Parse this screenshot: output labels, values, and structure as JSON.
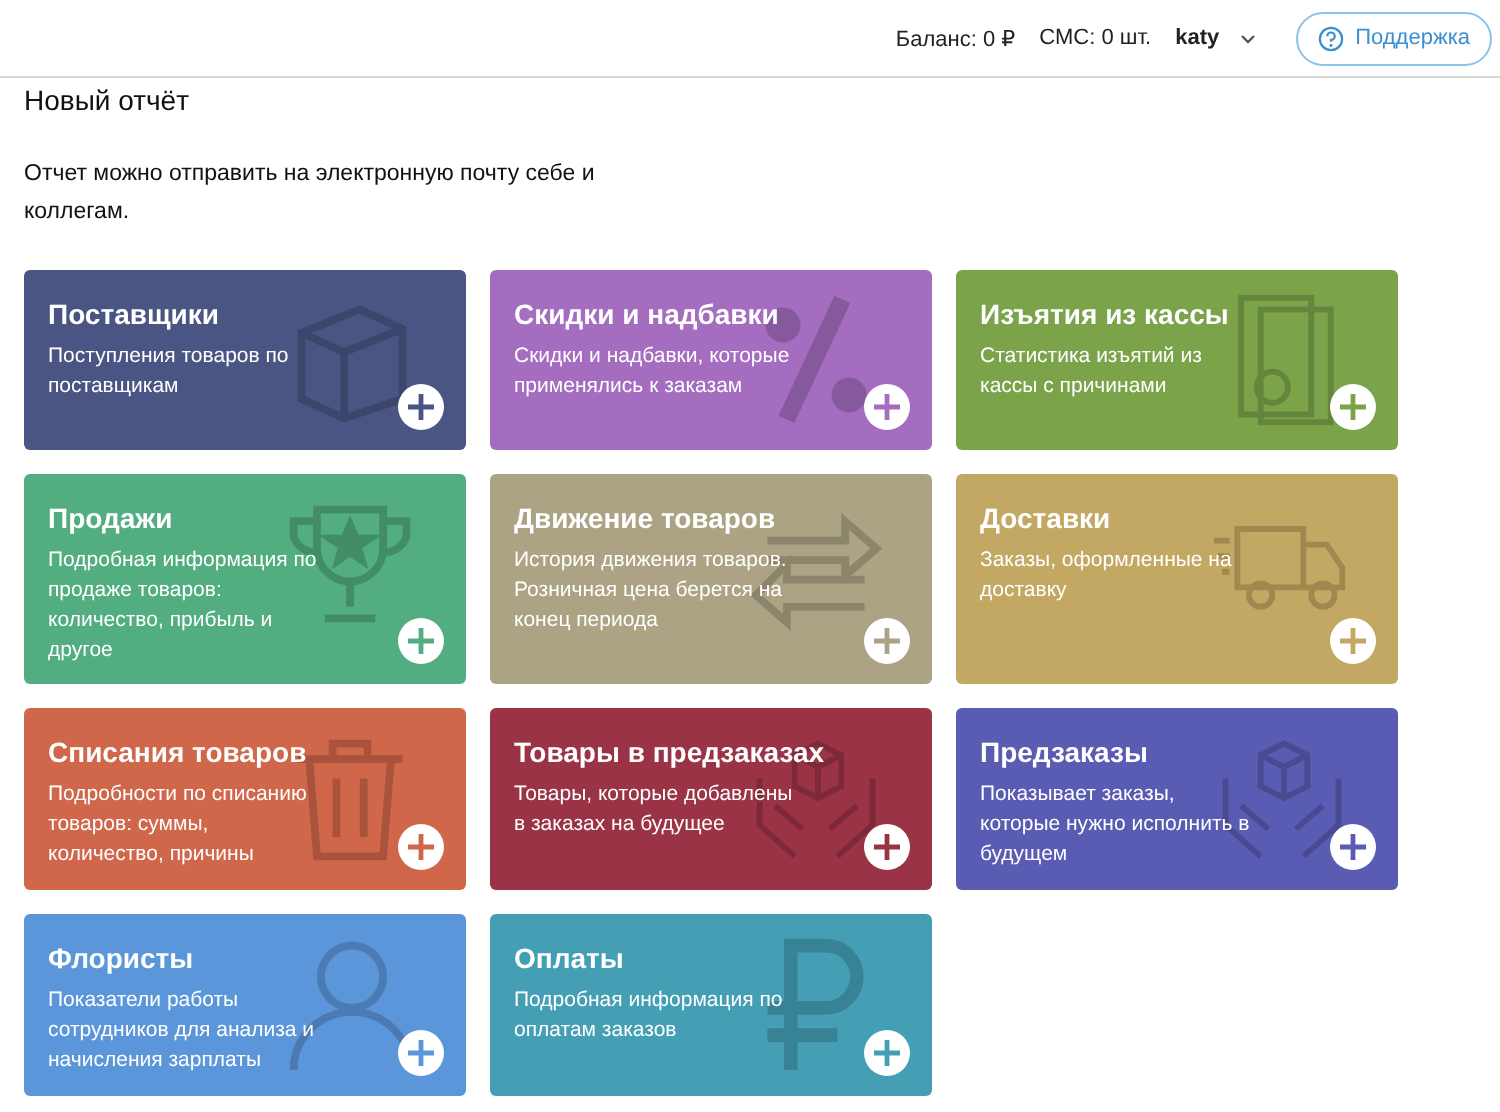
{
  "header": {
    "balance": "Баланс: 0 ₽",
    "sms": "СМС: 0 шт.",
    "user": "katy",
    "support_button": "Поддержка"
  },
  "page": {
    "title": "Новый отчёт",
    "description": "Отчет можно отправить на электронную почту себе и коллегам."
  },
  "reports": [
    {
      "title": "Поставщики",
      "description": "Поступления товаров по поставщикам",
      "color": "#4a5584"
    },
    {
      "title": "Скидки и надбавки",
      "description": "Скидки и надбавки, которые применялись к заказам",
      "color": "#a56dc0"
    },
    {
      "title": "Изъятия из кассы",
      "description": "Статистика изъятий из кассы с причинами",
      "color": "#7aa34a"
    },
    {
      "title": "Продажи",
      "description": "Подробная информация по продаже товаров: количество, прибыль и другое",
      "color": "#52ad80"
    },
    {
      "title": "Движение товаров",
      "description": "История движения товаров. Розничная цена берется на конец периода",
      "color": "#aba384"
    },
    {
      "title": "Доставки",
      "description": "Заказы, оформленные на доставку",
      "color": "#c3a863"
    },
    {
      "title": "Списания товаров",
      "description": "Подробности по списанию товаров: суммы, количество, причины",
      "color": "#d0664a"
    },
    {
      "title": "Товары в предзаказах",
      "description": "Товары, которые добавлены в заказах на будущее",
      "color": "#9a3345"
    },
    {
      "title": "Предзаказы",
      "description": "Показывает заказы, которые нужно исполнить в будущем",
      "color": "#5a5bb3"
    },
    {
      "title": "Флористы",
      "description": "Показатели работы сотрудников для анализа и начисления зарплаты",
      "color": "#5b96da"
    },
    {
      "title": "Оплаты",
      "description": "Подробная информация по оплатам заказов",
      "color": "#449fb5"
    }
  ]
}
